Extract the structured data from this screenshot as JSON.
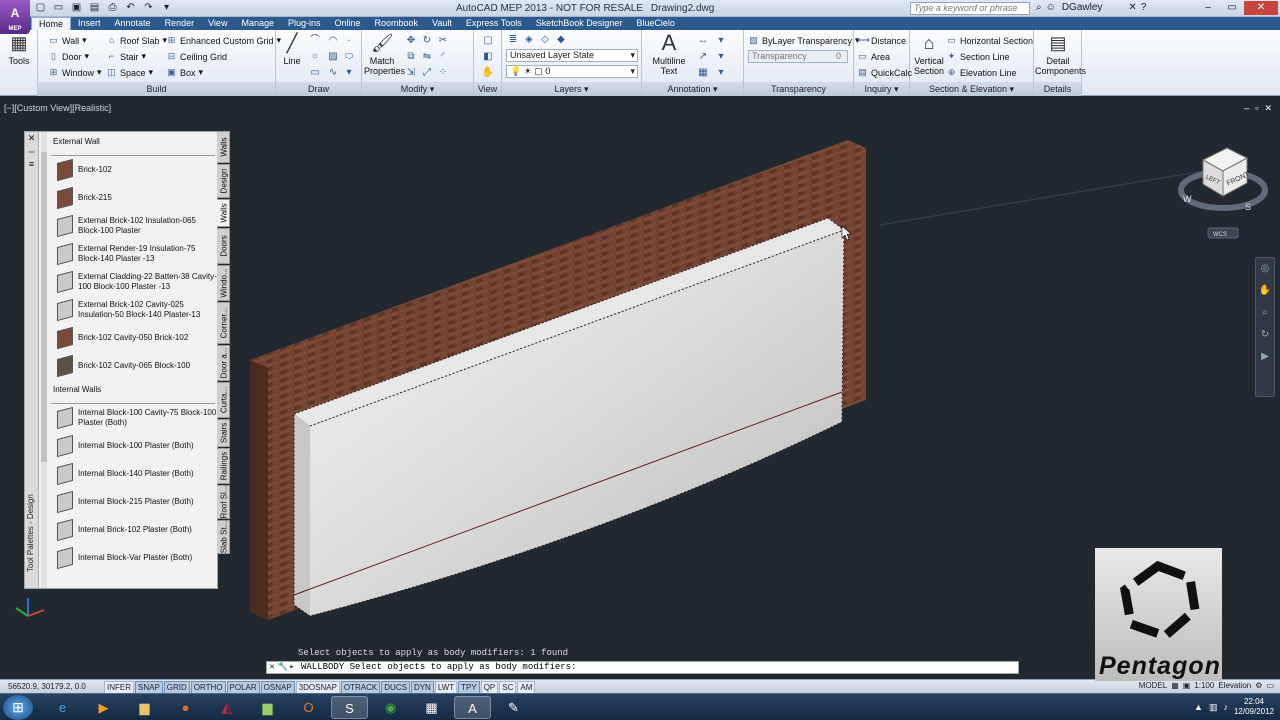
{
  "app": {
    "logo": "A",
    "logo_sub": "MEP",
    "title": "AutoCAD MEP 2013 - NOT FOR RESALE",
    "file": "Drawing2.dwg"
  },
  "search": {
    "placeholder": "Type a keyword or phrase"
  },
  "user": {
    "name": "DGawley"
  },
  "tabs": [
    "Home",
    "Insert",
    "Annotate",
    "Render",
    "View",
    "Manage",
    "Plug-ins",
    "Online",
    "Roombook",
    "Vault",
    "Express Tools",
    "SketchBook Designer",
    "BlueCielo"
  ],
  "ribbon": {
    "tools": "Tools",
    "build": {
      "label": "Build",
      "items": [
        "Wall",
        "Door",
        "Window",
        "Roof Slab",
        "Stair",
        "Space",
        "Enhanced Custom Grid",
        "Ceiling Grid",
        "Box"
      ]
    },
    "draw": {
      "label": "Draw",
      "line": "Line"
    },
    "modify": {
      "label": "Modify",
      "match": "Match Properties"
    },
    "view": {
      "label": "View"
    },
    "layers": {
      "label": "Layers",
      "state": "Unsaved Layer State",
      "current": "0"
    },
    "annotation": {
      "label": "Annotation",
      "mtext": "Multiline Text"
    },
    "transparency": {
      "label": "Transparency",
      "bylayer": "ByLayer Transparency",
      "field": "Transparency",
      "value": "0"
    },
    "inquiry": {
      "label": "Inquiry",
      "items": [
        "Distance",
        "Area",
        "QuickCalc"
      ]
    },
    "section": {
      "label": "Section & Elevation",
      "vertical": "Vertical Section",
      "items": [
        "Horizontal Section",
        "Section Line",
        "Elevation Line"
      ]
    },
    "details": {
      "label": "Details",
      "btn": "Detail Components"
    }
  },
  "viewport": {
    "label": "[−][Custom View][Realistic]",
    "wcs": "WCS",
    "cube_face": "FRONT",
    "cube_top": "LEFT",
    "compass": {
      "w": "W",
      "s": "S"
    }
  },
  "palette": {
    "title": "Tool Palettes - Design",
    "sections": [
      {
        "name": "External Wall",
        "items": [
          {
            "label": "Brick-102",
            "sw": "brick"
          },
          {
            "label": "Brick-215",
            "sw": "brick"
          },
          {
            "label": "External Brick-102 Insulation-065 Block-100 Plaster",
            "sw": "light"
          },
          {
            "label": "External Render-19 Insulation-75 Block-140 Plaster -13",
            "sw": "light"
          },
          {
            "label": "External Cladding-22 Batten-38 Cavity-100 Block-100 Plaster -13",
            "sw": "light"
          },
          {
            "label": "External Brick-102 Cavity-025 Insulation-50 Block-140 Plaster-13",
            "sw": "light"
          },
          {
            "label": "Brick-102 Cavity-050 Brick-102",
            "sw": "brick"
          },
          {
            "label": "Brick-102 Cavity-065 Block-100",
            "sw": "dark"
          }
        ]
      },
      {
        "name": "Internal Walls",
        "items": [
          {
            "label": "Internal Block-100 Cavity-75 Block-100 Plaster (Both)",
            "sw": "light"
          },
          {
            "label": "Internal Block-100 Plaster (Both)",
            "sw": "light"
          },
          {
            "label": "Internal Block-140 Plaster (Both)",
            "sw": "light"
          },
          {
            "label": "Internal Block-215 Plaster (Both)",
            "sw": "light"
          },
          {
            "label": "Internal Brick-102 Plaster (Both)",
            "sw": "light"
          },
          {
            "label": "Internal Block-Var Plaster (Both)",
            "sw": "light"
          }
        ]
      }
    ],
    "tabs": [
      "Walls",
      "Design",
      "Walls",
      "Doors",
      "Windo...",
      "Corner...",
      "Door a...",
      "Curta...",
      "Stairs",
      "Railings",
      "Roof Sl...",
      "Slab St..."
    ]
  },
  "command": {
    "history": "Select objects to apply as body modifiers: 1 found",
    "prompt": "WALLBODY Select objects to apply as body modifiers:"
  },
  "watermark": "Pentagon",
  "status": {
    "coords": "56520.9, 30179.2, 0.0",
    "toggles": [
      "INFER",
      "SNAP",
      "GRID",
      "ORTHO",
      "POLAR",
      "OSNAP",
      "3DOSNAP",
      "OTRACK",
      "DUCS",
      "DYN",
      "LWT",
      "TPY",
      "QP",
      "SC",
      "AM"
    ],
    "on": [
      "SNAP",
      "GRID",
      "ORTHO",
      "POLAR",
      "OSNAP",
      "OTRACK",
      "DUCS",
      "DYN",
      "TPY"
    ],
    "model": "MODEL",
    "scale": "1:100",
    "elevation": "Elevation"
  },
  "taskbar": {
    "time": "22:04",
    "date": "12/09/2012"
  },
  "colors": {
    "brick": "#6b3f2f",
    "viewport": "#212830",
    "ribbon_tab": "#2d5a8c",
    "accent": "#1f5fae"
  }
}
